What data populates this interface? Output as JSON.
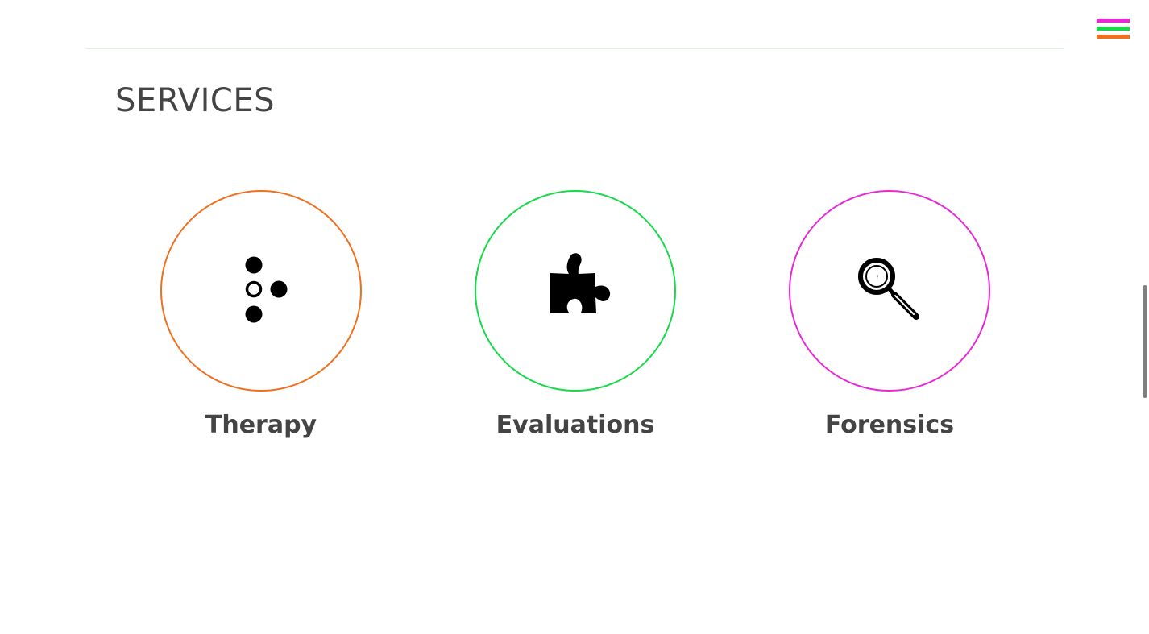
{
  "header": {
    "menu_icon": "hamburger-menu-icon",
    "menu_colors": [
      "#e62ad6",
      "#17d94a",
      "#f07020"
    ]
  },
  "section": {
    "title": "SERVICES"
  },
  "services": [
    {
      "label": "Therapy",
      "icon": "braille-dots-icon",
      "color": "#f07020"
    },
    {
      "label": "Evaluations",
      "icon": "puzzle-piece-icon",
      "color": "#17d94a"
    },
    {
      "label": "Forensics",
      "icon": "magnifying-glass-icon",
      "color": "#e62ad6",
      "icon_text": "?"
    }
  ]
}
